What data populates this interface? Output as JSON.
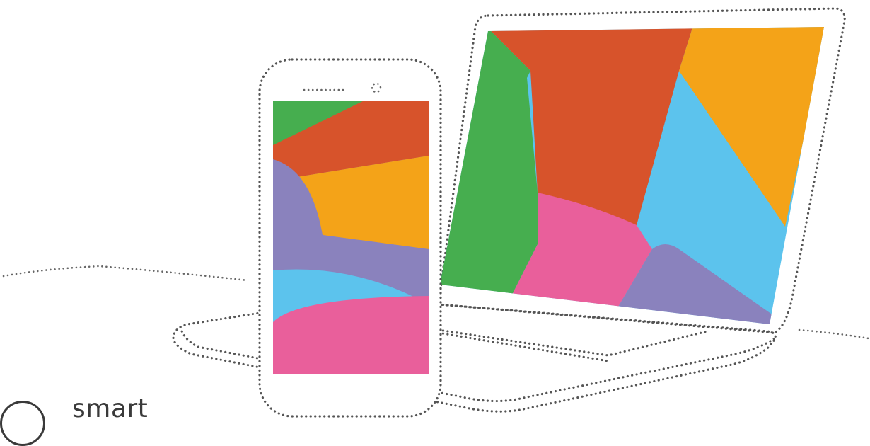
{
  "illustration": {
    "devices": [
      "smartphone",
      "laptop"
    ],
    "palette": {
      "green": "#46ae4f",
      "orange_red": "#d7532b",
      "orange": "#f4a318",
      "light_blue": "#5cc3ed",
      "pink": "#e95f9b",
      "purple": "#8a82bd",
      "outline": "#555555"
    }
  },
  "logo": {
    "text": "smart",
    "icon": "circle-logo-icon"
  }
}
